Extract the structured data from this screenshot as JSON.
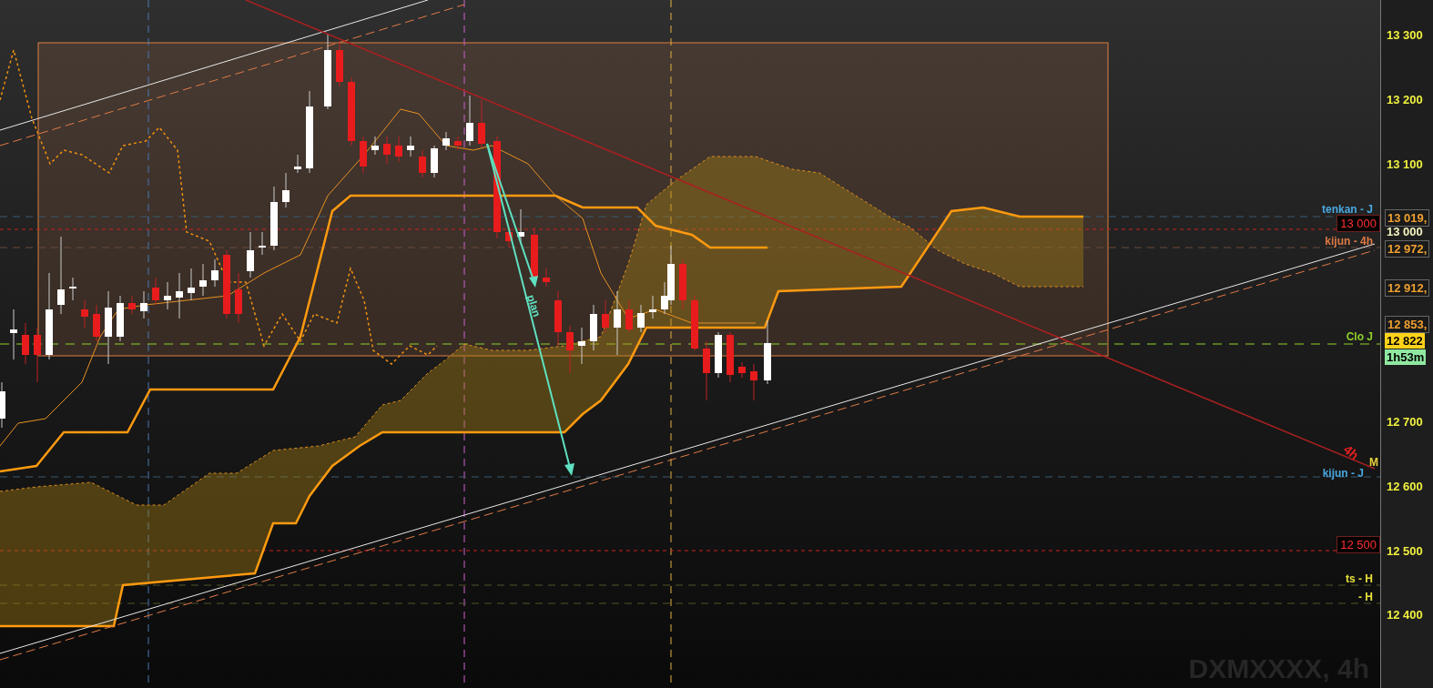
{
  "chart": {
    "symbol_label": "DXMXXXX, 4h",
    "line_labels": [
      {
        "text": "tenkan - J",
        "color": "#4aa8e0"
      },
      {
        "text": "kijun - 4h",
        "color": "#e07a45"
      },
      {
        "text": "Clo J",
        "color": "#8fd12a"
      },
      {
        "text": "kijun - J",
        "color": "#4aa8e0"
      },
      {
        "text": "M",
        "color": "#e8d23a"
      },
      {
        "text": "ts - H",
        "color": "#e8e03a"
      },
      {
        "text": "- H",
        "color": "#e8e03a"
      }
    ],
    "alert_labels": [
      "13 000",
      "12 500"
    ],
    "drawing_labels": [
      {
        "text": "plan",
        "color": "#5fe0c0"
      },
      {
        "text": "4h",
        "color": "#e02020"
      }
    ]
  },
  "price_axis": {
    "ticks": [
      "13 300",
      "13 200",
      "13 100",
      "12 700",
      "12 600",
      "12 500",
      "12 400"
    ],
    "markers": [
      {
        "text": "13 019,",
        "kind": "level"
      },
      {
        "text": "13 000",
        "kind": "alert"
      },
      {
        "text": "12 972,",
        "kind": "level"
      },
      {
        "text": "12 912,",
        "kind": "level"
      },
      {
        "text": "12 853,",
        "kind": "level"
      },
      {
        "text": "12 822",
        "kind": "price"
      },
      {
        "text": "1h53m",
        "kind": "countdown"
      }
    ]
  }
}
